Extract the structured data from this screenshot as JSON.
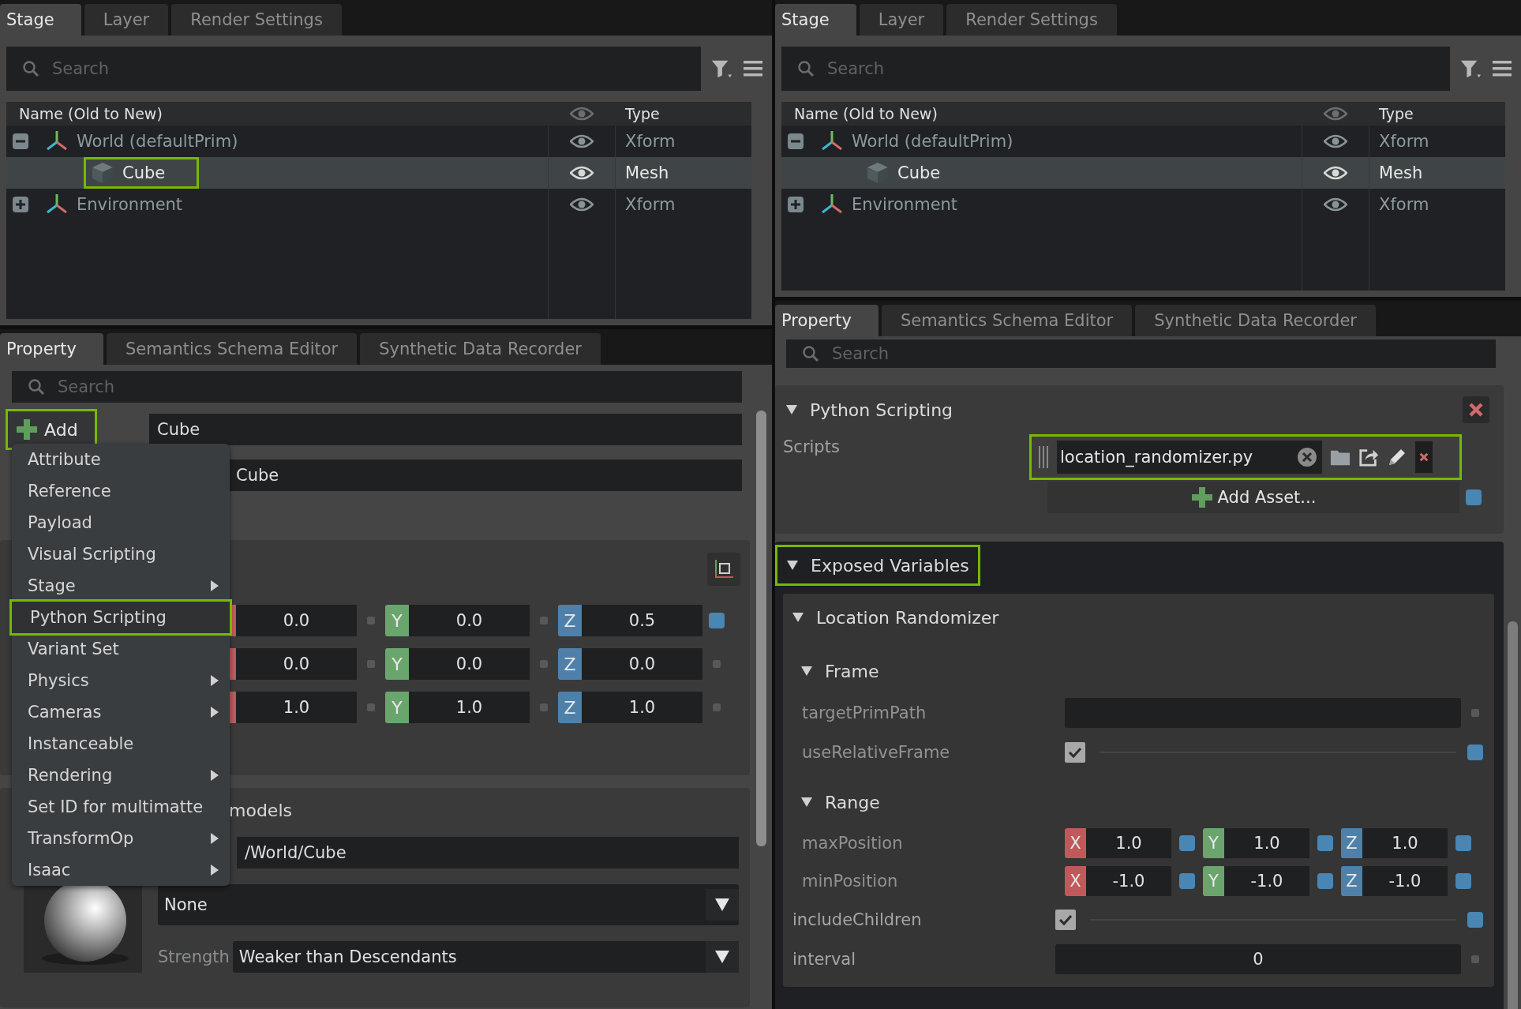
{
  "panels": [
    {
      "stage_tabs": [
        {
          "label": "Stage",
          "selected": true
        },
        {
          "label": "Layer",
          "selected": false
        },
        {
          "label": "Render Settings",
          "selected": false
        }
      ],
      "stage_search": {
        "placeholder": "Search"
      },
      "tree_columns": {
        "name": "Name (Old to New)",
        "type": "Type"
      },
      "tree": [
        {
          "name": "World (defaultPrim)",
          "kind": "xform",
          "type": "Xform",
          "expanded": true,
          "selected": false,
          "highlighted": false,
          "children": [
            {
              "name": "Cube",
              "kind": "mesh",
              "type": "Mesh",
              "selected": true,
              "highlighted": true
            }
          ]
        },
        {
          "name": "Environment",
          "kind": "xform",
          "type": "Xform",
          "expanded": false,
          "selected": false,
          "highlighted": false
        }
      ],
      "property_tabs": [
        {
          "label": "Property",
          "selected": true
        },
        {
          "label": "Semantics Schema Editor",
          "selected": false
        },
        {
          "label": "Synthetic Data Recorder",
          "selected": false
        }
      ],
      "property_search": {
        "placeholder": "Search"
      },
      "prim": {
        "add_button": {
          "label": "Add",
          "highlighted": true
        },
        "name_field": {
          "value": "Cube"
        },
        "second_field": {
          "value": "Cube"
        },
        "transform_rows": [
          {
            "components": [
              {
                "value": "0.0",
                "modified": false
              },
              {
                "label": "Y",
                "value": "0.0",
                "modified": false
              },
              {
                "label": "Z",
                "value": "0.5",
                "modified": true
              }
            ]
          },
          {
            "components": [
              {
                "value": "0.0",
                "modified": false
              },
              {
                "label": "Y",
                "value": "0.0",
                "modified": false
              },
              {
                "label": "Z",
                "value": "0.0",
                "modified": false
              }
            ]
          },
          {
            "components": [
              {
                "value": "1.0",
                "modified": false
              },
              {
                "label": "Y",
                "value": "1.0",
                "modified": false
              },
              {
                "label": "Z",
                "value": "1.0",
                "modified": false
              }
            ]
          }
        ],
        "materials": {
          "title": "models",
          "path": "/World/Cube",
          "material": "None",
          "strength_label": "Strength",
          "strength": "Weaker than Descendants"
        }
      },
      "add_menu": [
        {
          "label": "Attribute",
          "submenu": false,
          "highlighted": false
        },
        {
          "label": "Reference",
          "submenu": false,
          "highlighted": false
        },
        {
          "label": "Payload",
          "submenu": false,
          "highlighted": false
        },
        {
          "label": "Visual Scripting",
          "submenu": false,
          "highlighted": false
        },
        {
          "label": "Stage",
          "submenu": true,
          "highlighted": false
        },
        {
          "label": "Python Scripting",
          "submenu": false,
          "highlighted": true
        },
        {
          "label": "Variant Set",
          "submenu": false,
          "highlighted": false
        },
        {
          "label": "Physics",
          "submenu": true,
          "highlighted": false
        },
        {
          "label": "Cameras",
          "submenu": true,
          "highlighted": false
        },
        {
          "label": "Instanceable",
          "submenu": false,
          "highlighted": false
        },
        {
          "label": "Rendering",
          "submenu": true,
          "highlighted": false
        },
        {
          "label": "Set ID for multimatte",
          "submenu": false,
          "highlighted": false
        },
        {
          "label": "TransformOp",
          "submenu": true,
          "highlighted": false
        },
        {
          "label": "Isaac",
          "submenu": true,
          "highlighted": false
        }
      ]
    },
    {
      "stage_tabs": [
        {
          "label": "Stage",
          "selected": true
        },
        {
          "label": "Layer",
          "selected": false
        },
        {
          "label": "Render Settings",
          "selected": false
        }
      ],
      "stage_search": {
        "placeholder": "Search"
      },
      "tree_columns": {
        "name": "Name (Old to New)",
        "type": "Type"
      },
      "tree": [
        {
          "name": "World (defaultPrim)",
          "kind": "xform",
          "type": "Xform",
          "expanded": true,
          "selected": false,
          "highlighted": false,
          "children": [
            {
              "name": "Cube",
              "kind": "mesh",
              "type": "Mesh",
              "selected": true,
              "highlighted": false
            }
          ]
        },
        {
          "name": "Environment",
          "kind": "xform",
          "type": "Xform",
          "expanded": false,
          "selected": false,
          "highlighted": false
        }
      ],
      "property_tabs": [
        {
          "label": "Property",
          "selected": true
        },
        {
          "label": "Semantics Schema Editor",
          "selected": false
        },
        {
          "label": "Synthetic Data Recorder",
          "selected": false
        }
      ],
      "property_search": {
        "placeholder": "Search"
      },
      "scripting": {
        "title": "Python Scripting",
        "expanded": true,
        "scripts_label": "Scripts",
        "script": {
          "value": "location_randomizer.py",
          "highlighted": true
        },
        "add_asset": "Add Asset...",
        "exposed": {
          "title": "Exposed Variables",
          "expanded": true,
          "highlighted": true,
          "children": [
            {
              "kind": "group",
              "title": "Location Randomizer",
              "expanded": true,
              "children": [
                {
                  "kind": "group",
                  "title": "Frame",
                  "expanded": true,
                  "children": [
                    {
                      "kind": "text",
                      "label": "targetPrimPath",
                      "modified": false
                    },
                    {
                      "kind": "checkbox",
                      "label": "useRelativeFrame",
                      "checked": true,
                      "modified": true
                    }
                  ]
                },
                {
                  "kind": "group",
                  "title": "Range",
                  "expanded": true,
                  "children": [
                    {
                      "kind": "vec3",
                      "label": "maxPosition",
                      "components": [
                        {
                          "label": "X",
                          "value": "1.0",
                          "modified": true
                        },
                        {
                          "label": "Y",
                          "value": "1.0",
                          "modified": true
                        },
                        {
                          "label": "Z",
                          "value": "1.0",
                          "modified": true
                        }
                      ]
                    },
                    {
                      "kind": "vec3",
                      "label": "minPosition",
                      "components": [
                        {
                          "label": "X",
                          "value": "-1.0",
                          "modified": true
                        },
                        {
                          "label": "Y",
                          "value": "-1.0",
                          "modified": true
                        },
                        {
                          "label": "Z",
                          "value": "-1.0",
                          "modified": true
                        }
                      ]
                    }
                  ]
                },
                {
                  "kind": "checkbox",
                  "label": "includeChildren",
                  "checked": true,
                  "modified": true
                },
                {
                  "kind": "number",
                  "label": "interval",
                  "value": "0",
                  "modified": false
                }
              ]
            }
          ]
        }
      }
    }
  ]
}
